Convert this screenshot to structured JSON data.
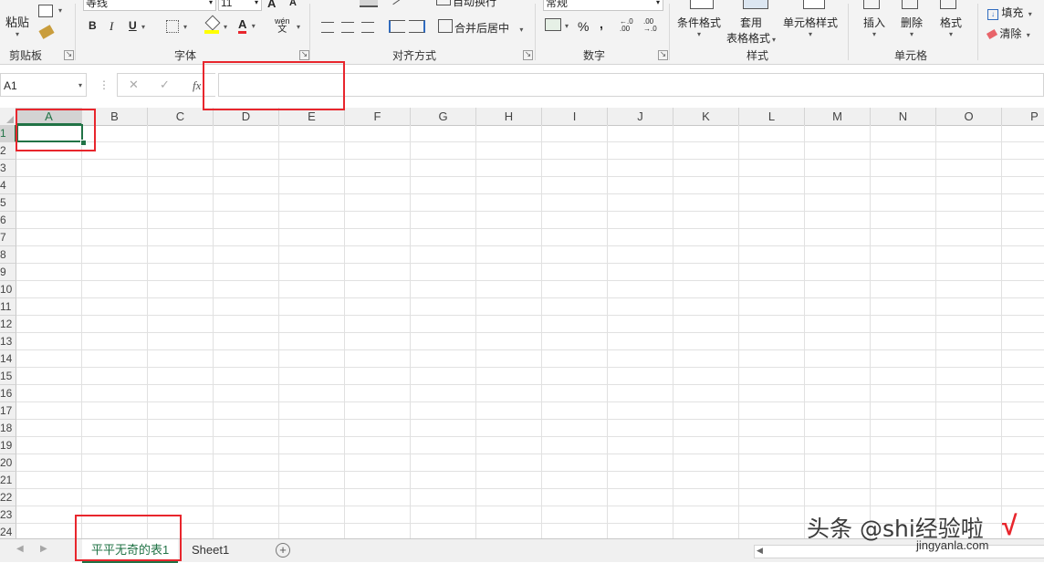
{
  "ribbon": {
    "clipboard": {
      "paste_label": "粘贴",
      "group_label": "剪贴板"
    },
    "font": {
      "font_name": "等线",
      "font_size": "11",
      "bold": "B",
      "italic": "I",
      "underline": "U",
      "grow_font": "A",
      "shrink_font": "A",
      "font_color": "A",
      "phonetic_top": "wén",
      "phonetic_bottom": "文",
      "group_label": "字体"
    },
    "alignment": {
      "wrap_text": "自动换行",
      "merge_center": "合并后居中",
      "group_label": "对齐方式"
    },
    "number": {
      "format": "常规",
      "percent": "%",
      "comma": ",",
      "increase_decimal": "←.0 .00",
      "decrease_decimal": ".00 →.0",
      "group_label": "数字"
    },
    "styles": {
      "conditional_format": "条件格式",
      "table_format_1": "套用",
      "table_format_2": "表格格式",
      "cell_styles": "单元格样式",
      "group_label": "样式"
    },
    "cells": {
      "insert": "插入",
      "delete": "删除",
      "format": "格式",
      "group_label": "单元格"
    },
    "editing": {
      "fill": "填充",
      "clear": "清除"
    }
  },
  "formula_bar": {
    "name_box": "A1",
    "cancel": "✕",
    "enter": "✓",
    "fx": "fx",
    "formula": ""
  },
  "columns": [
    "A",
    "B",
    "C",
    "D",
    "E",
    "F",
    "G",
    "H",
    "I",
    "J",
    "K",
    "L",
    "M",
    "N",
    "O",
    "P"
  ],
  "rows": [
    "1",
    "2",
    "3",
    "4",
    "5",
    "6",
    "7",
    "8",
    "9",
    "10",
    "11",
    "12",
    "13",
    "14",
    "15",
    "16",
    "17",
    "18",
    "19",
    "20",
    "21",
    "22",
    "23",
    "24"
  ],
  "sheet_tabs": [
    {
      "label": "平平无奇的表1",
      "active": true
    },
    {
      "label": "Sheet1",
      "active": false
    }
  ],
  "watermark": {
    "main": "头条 @shi经验啦",
    "sub": "jingyanla.com"
  },
  "colors": {
    "accent_green": "#217346",
    "annotation_red": "#e8262d"
  }
}
